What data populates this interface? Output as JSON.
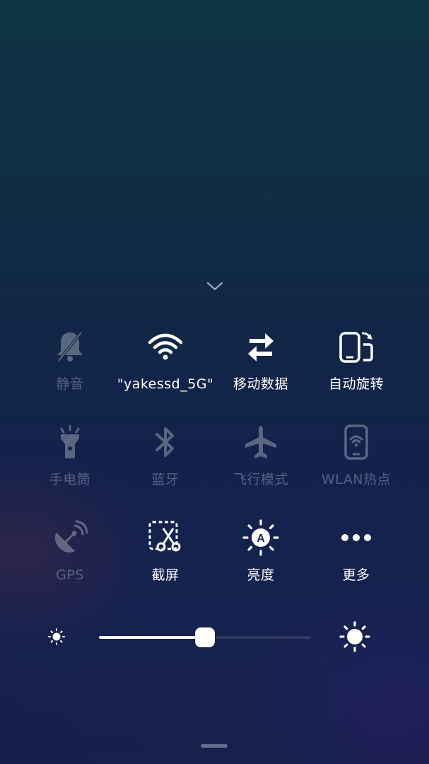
{
  "panel": {
    "collapse_icon": "chevron-down-icon",
    "tiles": [
      {
        "id": "mute",
        "label": "静音",
        "icon": "bell-off-icon",
        "state": "off"
      },
      {
        "id": "wifi",
        "label": "\"yakessd_5G\"",
        "icon": "wifi-icon",
        "state": "on"
      },
      {
        "id": "mobile-data",
        "label": "移动数据",
        "icon": "data-arrows-icon",
        "state": "on"
      },
      {
        "id": "auto-rotate",
        "label": "自动旋转",
        "icon": "rotate-phone-icon",
        "state": "on"
      },
      {
        "id": "flashlight",
        "label": "手电筒",
        "icon": "flashlight-icon",
        "state": "off"
      },
      {
        "id": "bluetooth",
        "label": "蓝牙",
        "icon": "bluetooth-icon",
        "state": "off"
      },
      {
        "id": "airplane",
        "label": "飞行模式",
        "icon": "airplane-icon",
        "state": "off"
      },
      {
        "id": "hotspot",
        "label": "WLAN热点",
        "icon": "hotspot-phone-icon",
        "state": "off"
      },
      {
        "id": "gps",
        "label": "GPS",
        "icon": "gps-satellite-icon",
        "state": "off"
      },
      {
        "id": "screenshot",
        "label": "截屏",
        "icon": "scissors-icon",
        "state": "on"
      },
      {
        "id": "brightness",
        "label": "亮度",
        "icon": "auto-brightness-icon",
        "state": "on"
      },
      {
        "id": "more",
        "label": "更多",
        "icon": "more-dots-icon",
        "state": "on"
      }
    ]
  },
  "brightness": {
    "low_icon": "sun-small-icon",
    "high_icon": "sun-large-icon",
    "level": 0.5
  },
  "colors": {
    "active": "#ffffff",
    "inactive": "#9aa6bb",
    "background_top": "#0e3442",
    "background_bottom": "#171f4a"
  }
}
